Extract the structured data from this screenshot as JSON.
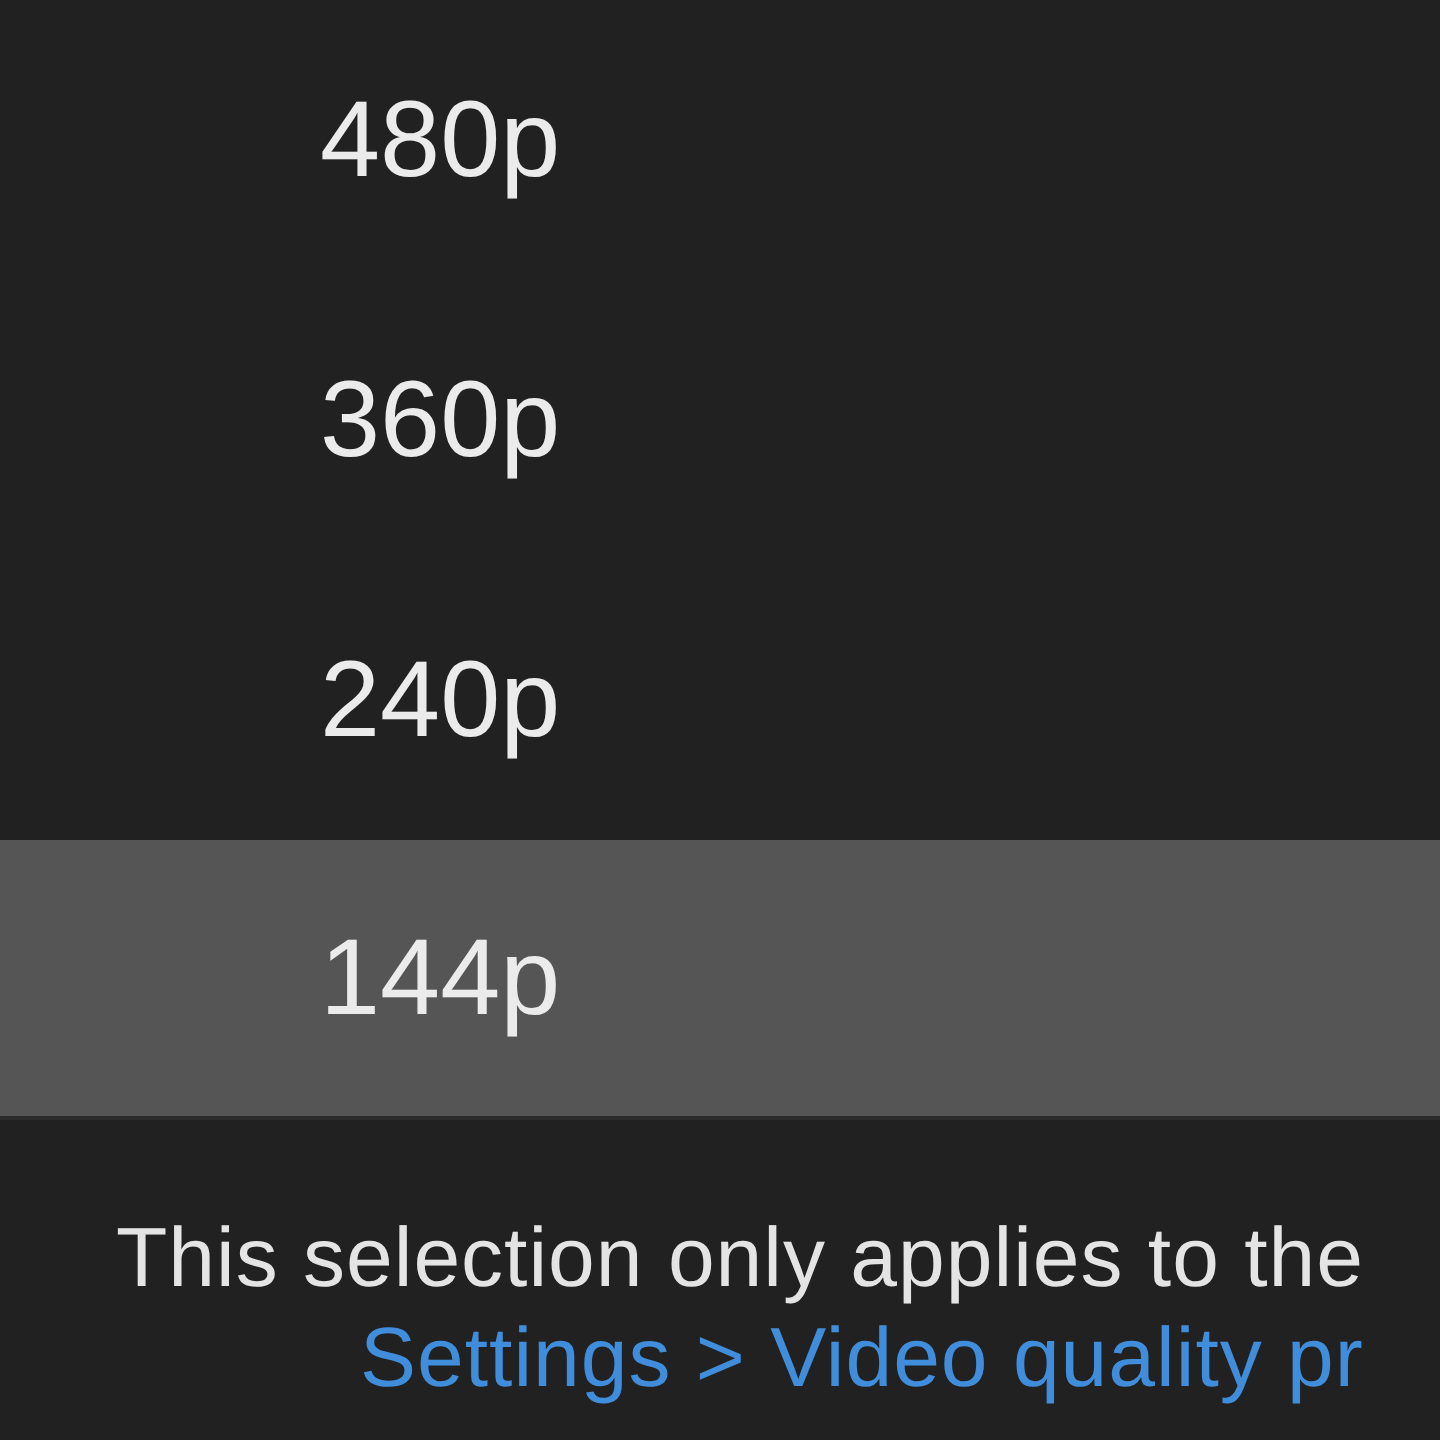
{
  "options": [
    {
      "label": "480p",
      "selected": false
    },
    {
      "label": "360p",
      "selected": false
    },
    {
      "label": "240p",
      "selected": false
    },
    {
      "label": "144p",
      "selected": true
    }
  ],
  "footer": {
    "text": "This selection only applies to the",
    "link": "Settings > Video quality pr"
  }
}
